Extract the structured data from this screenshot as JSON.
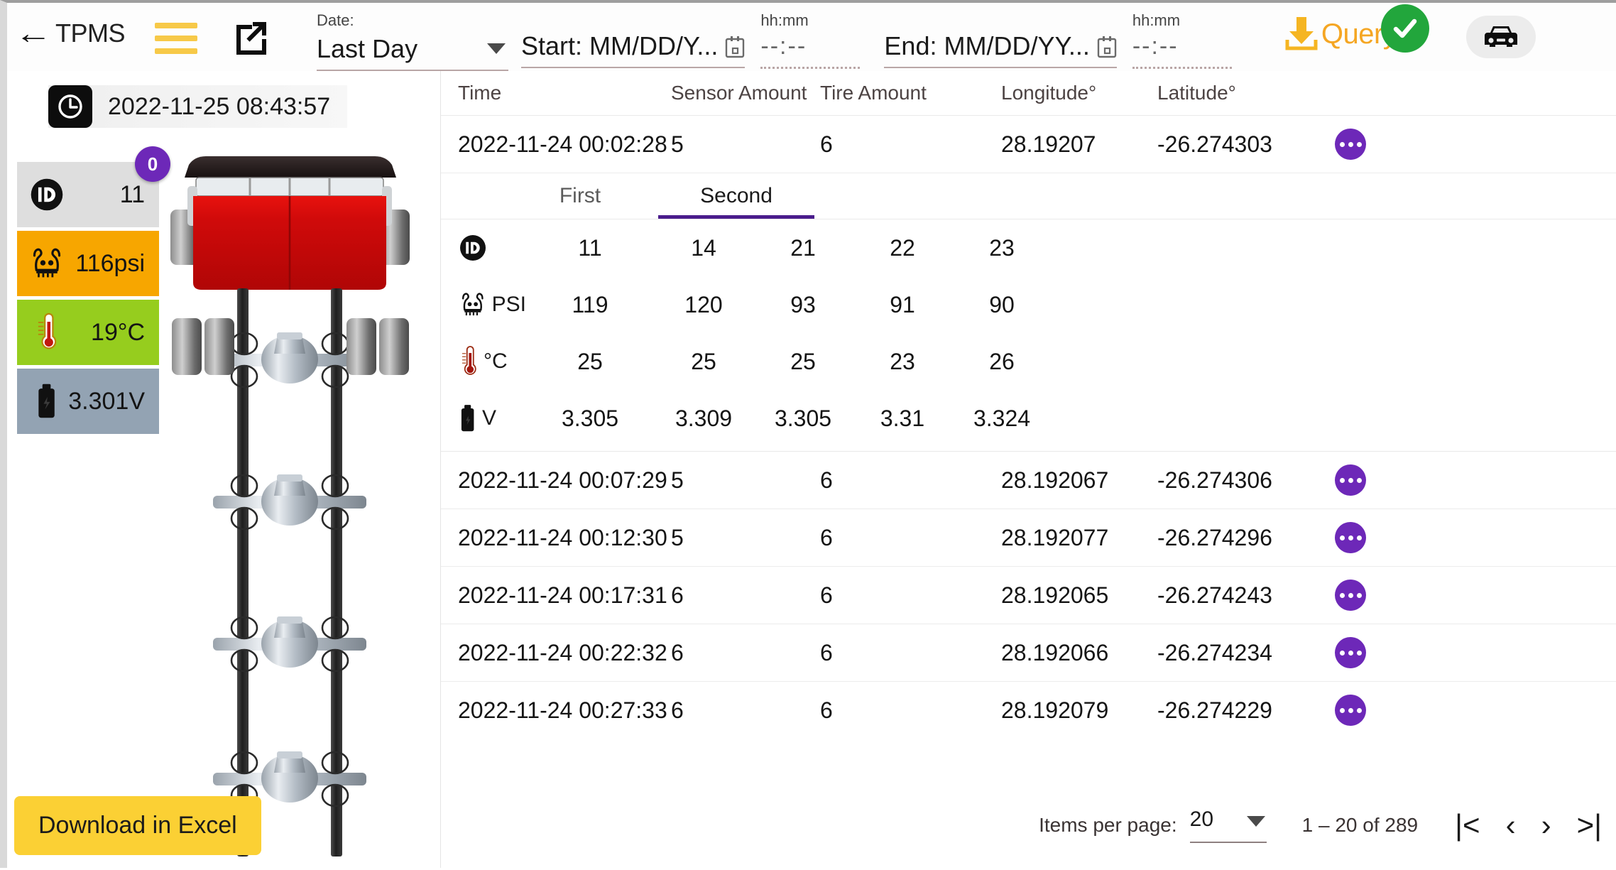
{
  "toolbar": {
    "back_label": "TPMS",
    "menu_icon": "hamburger-icon",
    "external_icon": "external-link-icon",
    "date_field": {
      "label": "Date:",
      "value": "Last Day"
    },
    "start_date": {
      "value": "Start: MM/DD/Y...",
      "icon": "calendar-icon"
    },
    "start_time": {
      "label": "hh:mm",
      "value": "--:--"
    },
    "end_date": {
      "value": "End: MM/DD/YY...",
      "icon": "calendar-icon"
    },
    "end_time": {
      "label": "hh:mm",
      "value": "--:--"
    },
    "query_label": "Query",
    "confirm_icon": "check-icon",
    "vehicle_icon": "car-icon",
    "accent_yellow": "#f7c948",
    "query_orange": "#f5a623",
    "confirm_green": "#22a63c"
  },
  "left": {
    "timestamp": "2022-11-25 08:43:57",
    "clock_icon": "clock-icon",
    "cards": [
      {
        "icon": "id-icon",
        "value": "11",
        "badge": "0",
        "bg": "#dedede"
      },
      {
        "icon": "tire-pressure-icon",
        "value": "116psi",
        "bg": "#f7a600"
      },
      {
        "icon": "thermometer-icon",
        "value": "19°C",
        "bg": "#96cd1e"
      },
      {
        "icon": "battery-icon",
        "value": "3.301V",
        "bg": "#93a3b3"
      }
    ],
    "vehicle_diagram": "truck-top-view-diagram"
  },
  "table": {
    "columns": [
      "Time",
      "Sensor Amount",
      "Tire Amount",
      "Longitude°",
      "Latitude°"
    ],
    "rows": [
      {
        "time": "2022-11-24 00:02:28",
        "sensor": "5",
        "tire": "6",
        "lon": "28.19207",
        "lat": "-26.274303",
        "expanded": true
      },
      {
        "time": "2022-11-24 00:07:29",
        "sensor": "5",
        "tire": "6",
        "lon": "28.192067",
        "lat": "-26.274306",
        "expanded": false
      },
      {
        "time": "2022-11-24 00:12:30",
        "sensor": "5",
        "tire": "6",
        "lon": "28.192077",
        "lat": "-26.274296",
        "expanded": false
      },
      {
        "time": "2022-11-24 00:17:31",
        "sensor": "6",
        "tire": "6",
        "lon": "28.192065",
        "lat": "-26.274243",
        "expanded": false
      },
      {
        "time": "2022-11-24 00:22:32",
        "sensor": "6",
        "tire": "6",
        "lon": "28.192066",
        "lat": "-26.274234",
        "expanded": false
      },
      {
        "time": "2022-11-24 00:27:33",
        "sensor": "6",
        "tire": "6",
        "lon": "28.192079",
        "lat": "-26.274229",
        "expanded": false
      }
    ],
    "row_action_icon": "more-options-icon"
  },
  "detail": {
    "tabs": [
      {
        "label": "First",
        "active": false
      },
      {
        "label": "Second",
        "active": true
      }
    ],
    "active_tab_color": "#4a1c8c",
    "metrics": [
      {
        "icon": "id-icon",
        "label": "",
        "values": [
          "11",
          "14",
          "21",
          "22",
          "23"
        ]
      },
      {
        "icon": "tire-pressure-icon",
        "label": "PSI",
        "values": [
          "119",
          "120",
          "93",
          "91",
          "90"
        ]
      },
      {
        "icon": "thermometer-icon",
        "label": "°C",
        "values": [
          "25",
          "25",
          "25",
          "23",
          "26"
        ]
      },
      {
        "icon": "battery-icon",
        "label": "V",
        "values": [
          "3.305",
          "3.309",
          "3.305",
          "3.31",
          "3.324"
        ]
      }
    ]
  },
  "footer": {
    "download_label": "Download in Excel",
    "items_per_page_label": "Items per page:",
    "items_per_page_value": "20",
    "range_label": "1 – 20 of 289",
    "first_page_icon": "|<",
    "prev_page_icon": "‹",
    "next_page_icon": "›",
    "last_page_icon": ">|"
  }
}
